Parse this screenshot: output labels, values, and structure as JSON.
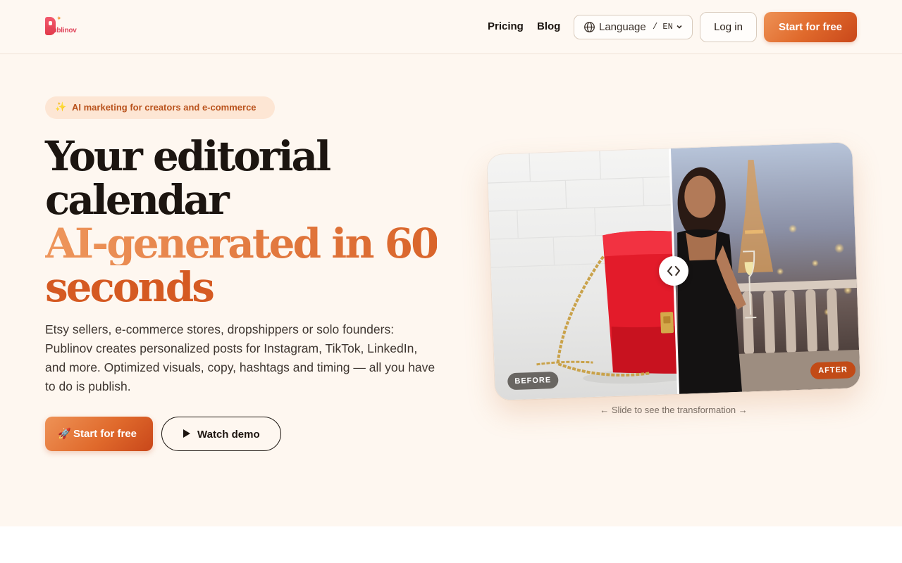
{
  "header": {
    "logo_text": "Publinov",
    "nav": [
      {
        "label": "Pricing"
      },
      {
        "label": "Blog"
      }
    ],
    "language": {
      "label": "Language",
      "code": "/ EN"
    },
    "login_label": "Log in",
    "start_label": "Start for free"
  },
  "hero": {
    "pill": {
      "icon": "sparkles-icon",
      "text": "AI marketing for creators and e-commerce"
    },
    "title_lines": [
      "Your editorial",
      "calendar",
      "AI-generated in 60",
      "seconds"
    ],
    "description": "Etsy sellers, e-commerce stores, dropshippers or solo founders: Publinov creates personalized posts for Instagram, TikTok, LinkedIn, and more. Optimized visuals, copy, hashtags and timing — all you have to do is publish.",
    "cta_primary": {
      "icon": "rocket-icon",
      "label": "Start for free"
    },
    "cta_secondary": {
      "icon": "play-icon",
      "label": "Watch demo"
    }
  },
  "comparison": {
    "before_label": "BEFORE",
    "after_label": "AFTER",
    "caption": "← Slide to see the transformation →",
    "slider_position": 0.5
  },
  "colors": {
    "accent": "#e06a2c",
    "accent_dark": "#c9471a",
    "hero_bg": "#fef7f0",
    "text": "#1c1510"
  }
}
